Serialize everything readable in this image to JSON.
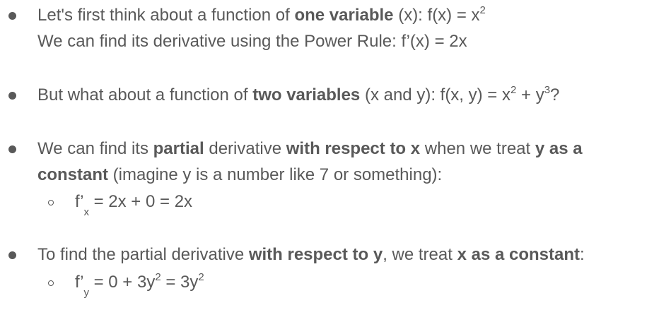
{
  "b1": {
    "l1_a": "Let's first think about a function of ",
    "l1_b": "one variable",
    "l1_c": " (x):  f(x) = x",
    "l1_sup": "2",
    "l2": "We can find its derivative using the Power Rule:  f’(x) = 2x"
  },
  "b2": {
    "a": "But what about a function of ",
    "b": "two variables",
    "c": " (x and y):  f(x, y) = x",
    "sup1": "2",
    "d": " + y",
    "sup2": "3",
    "e": "?"
  },
  "b3": {
    "l1_a": "We can find its ",
    "l1_b": "partial",
    "l1_c": " derivative ",
    "l1_d": "with respect to x",
    "l1_e": " when we treat ",
    "l1_f": "y as a",
    "l2_a": "constant",
    "l2_b": " (imagine y is a number like 7 or something):",
    "sub_f": "f’",
    "sub_x": "x",
    "sub_rest": " = 2x + 0 = 2x"
  },
  "b4": {
    "a": "To find the partial derivative ",
    "b": "with respect to y",
    "c": ", we treat ",
    "d": "x as a constant",
    "e": ":",
    "sub_f": "f’",
    "sub_y": "y",
    "sub_mid": " = 0 + 3y",
    "sup1": "2",
    "sub_mid2": " = 3y",
    "sup2": "2"
  }
}
